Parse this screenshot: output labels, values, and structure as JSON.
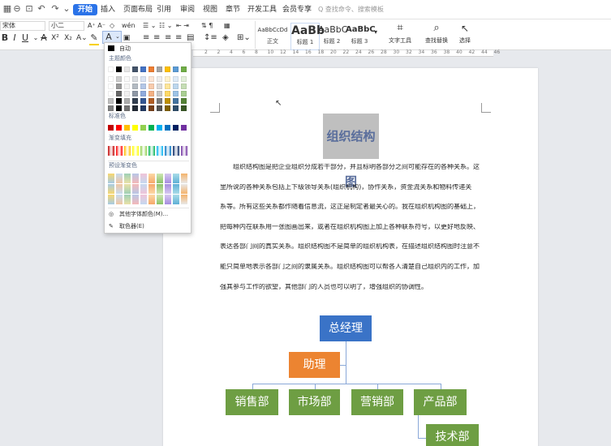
{
  "menu": {
    "items": [
      "开始",
      "插入",
      "页面布局",
      "引用",
      "审阅",
      "视图",
      "章节",
      "开发工具",
      "会员专享"
    ],
    "active_index": 0,
    "search_text": "Q 查找命令、搜索模板"
  },
  "ribbon": {
    "font_name": "宋体",
    "font_size": "小二",
    "styles": [
      {
        "sample": "AaBbCcDd",
        "name": "正文"
      },
      {
        "sample": "AaBb",
        "name": "标题 1"
      },
      {
        "sample": "AaBbC",
        "name": "标题 2"
      },
      {
        "sample": "AaBbC",
        "name": "标题 3"
      }
    ],
    "text_tools_label": "文字工具",
    "find_replace_label": "查找替换",
    "select_label": "选择"
  },
  "ruler": {
    "numbers": [
      "2",
      "2",
      "4",
      "6",
      "8",
      "10",
      "12",
      "14",
      "16",
      "18",
      "20",
      "22",
      "24",
      "26",
      "28",
      "30",
      "32",
      "34",
      "36",
      "38",
      "40",
      "42",
      "44",
      "46"
    ]
  },
  "document": {
    "title": "组织结构图",
    "paragraph_lines": [
      "组织结构图是把企业组织分成若干部分，并且标明各部分之间可能存在的各种关系。这",
      "里所说的各种关系包括上下级领导关系(组织机构)，协作关系，资金流关系和物料传递关",
      "系等。所有这些关系都作随着信息流，这正是制定者最关心的。我在组织机构图的基础上，",
      "把每种内在联系用一张图画出来，或者在组织机构图上加上各种联系符号，以更好地反映、",
      "表达各部门间的真实关系。组织结构图不是简单的组织机构表，在描述组织结构图时注意不",
      "能只简单地表示各部门之间的隶属关系。组织结构图可以帮各人清楚自己组织内的工作，加",
      "强其参与工作的欲望，其他部门的人员也可以明了，增强组织的协调性。"
    ],
    "org_chart": {
      "ceo": "总经理",
      "assistant": "助理",
      "departments": [
        "销售部",
        "市场部",
        "营销部",
        "产品部"
      ],
      "sub_department": "技术部"
    }
  },
  "color_dropdown": {
    "auto_label": "自动",
    "theme_label": "主题颜色",
    "standard_label": "标准色",
    "gradient_fill_label": "渐变填充",
    "preset_gradient_label": "预设渐变色",
    "more_colors_label": "其他字体颜色(M)...",
    "eyedropper_label": "取色器(E)",
    "theme_top_row": [
      "#ffffff",
      "#000000",
      "#e7e6e6",
      "#44546a",
      "#4472c4",
      "#ed7d31",
      "#a5a5a5",
      "#ffc000",
      "#5b9bd5",
      "#70ad47"
    ],
    "standard_colors": [
      "#c00000",
      "#ff0000",
      "#ffc000",
      "#ffff00",
      "#92d050",
      "#00b050",
      "#00b0f0",
      "#0070c0",
      "#002060",
      "#7030a0"
    ]
  },
  "colors": {
    "accent_blue": "#2b73e8",
    "org_blue": "#3a73c7",
    "org_orange": "#ec8431",
    "org_green": "#6e9e43"
  }
}
